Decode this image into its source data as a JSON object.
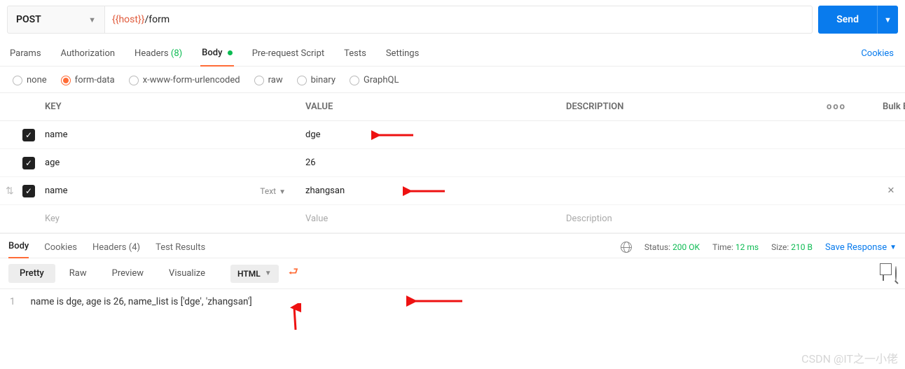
{
  "request": {
    "method": "POST",
    "url_var": "{{host}}",
    "url_rest": "/form",
    "send_label": "Send"
  },
  "req_tabs": {
    "params": "Params",
    "authorization": "Authorization",
    "headers": "Headers",
    "headers_count": "(8)",
    "body": "Body",
    "pre_request": "Pre-request Script",
    "tests": "Tests",
    "settings": "Settings",
    "cookies": "Cookies"
  },
  "body_types": {
    "none": "none",
    "form_data": "form-data",
    "x_www": "x-www-form-urlencoded",
    "raw": "raw",
    "binary": "binary",
    "graphql": "GraphQL"
  },
  "kv": {
    "head_key": "KEY",
    "head_value": "VALUE",
    "head_desc": "DESCRIPTION",
    "bulk_edit": "Bulk Edit",
    "rows": [
      {
        "key": "name",
        "value": "dge",
        "type": ""
      },
      {
        "key": "age",
        "value": "26",
        "type": ""
      },
      {
        "key": "name",
        "value": "zhangsan",
        "type": "Text"
      }
    ],
    "placeholder_key": "Key",
    "placeholder_value": "Value",
    "placeholder_desc": "Description"
  },
  "res_tabs": {
    "body": "Body",
    "cookies": "Cookies",
    "headers": "Headers",
    "headers_count": "(4)",
    "test_results": "Test Results"
  },
  "res_meta": {
    "status_label": "Status:",
    "status_value": "200 OK",
    "time_label": "Time:",
    "time_value": "12 ms",
    "size_label": "Size:",
    "size_value": "210 B",
    "save_response": "Save Response"
  },
  "view_modes": {
    "pretty": "Pretty",
    "raw": "Raw",
    "preview": "Preview",
    "visualize": "Visualize",
    "lang": "HTML"
  },
  "response_body": {
    "line_no": "1",
    "text": "name is dge, age is 26, name_list is ['dge', 'zhangsan']"
  },
  "watermark": "CSDN @IT之一小佬"
}
